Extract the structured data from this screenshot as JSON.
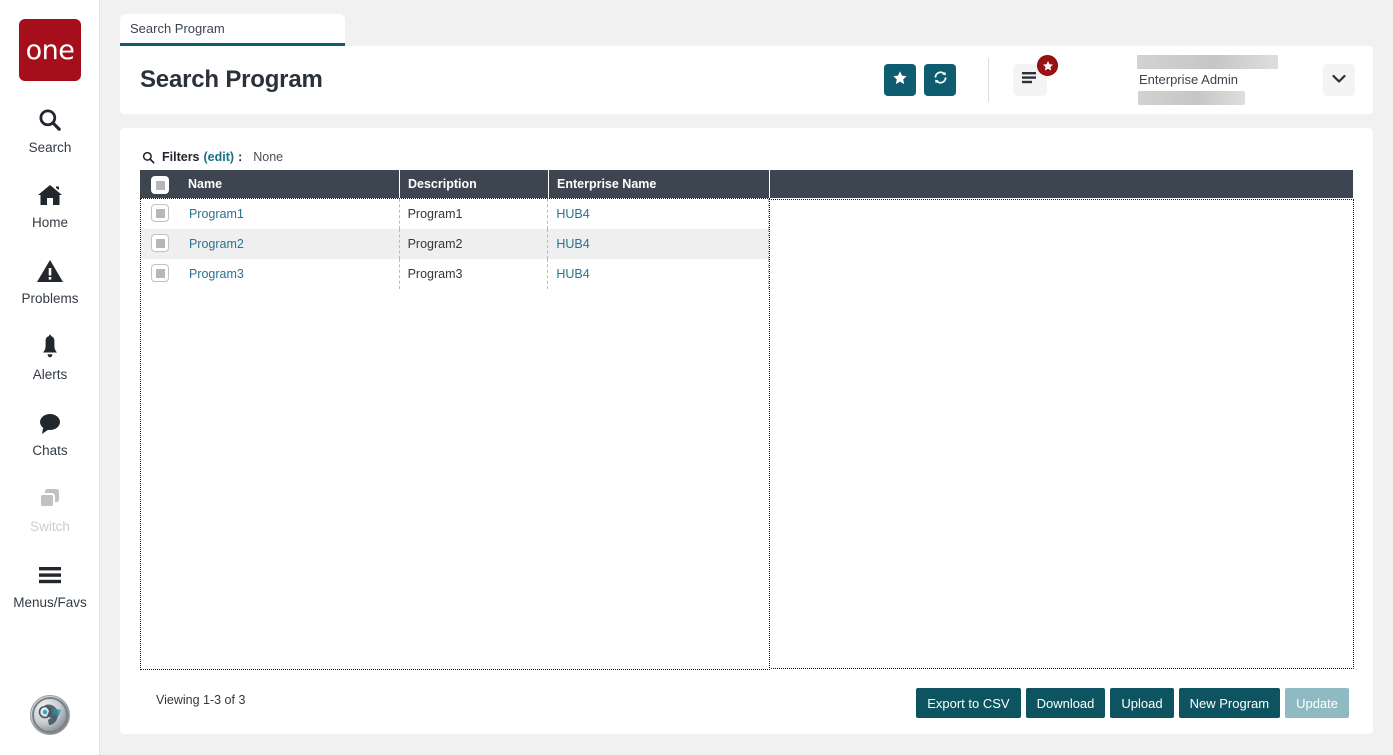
{
  "sidebar": {
    "logo_text": "one",
    "items": [
      {
        "label": "Search",
        "icon": "search-icon",
        "disabled": false
      },
      {
        "label": "Home",
        "icon": "home-icon",
        "disabled": false
      },
      {
        "label": "Problems",
        "icon": "warning-icon",
        "disabled": false
      },
      {
        "label": "Alerts",
        "icon": "bell-icon",
        "disabled": false
      },
      {
        "label": "Chats",
        "icon": "chat-icon",
        "disabled": false
      },
      {
        "label": "Switch",
        "icon": "switch-icon",
        "disabled": true
      },
      {
        "label": "Menus/Favs",
        "icon": "hamburger-icon",
        "disabled": false
      }
    ]
  },
  "tab": {
    "label": "Search Program"
  },
  "header": {
    "title": "Search Program",
    "favorite_icon": "star-icon",
    "refresh_icon": "refresh-icon",
    "menu_icon": "hamburger-menu-icon",
    "menu_badge_icon": "star-badge-icon",
    "user_role": "Enterprise Admin",
    "chevron_icon": "chevron-down-icon"
  },
  "filters": {
    "icon": "magnifier-icon",
    "label": "Filters",
    "edit_label": "(edit)",
    "colon": ":",
    "value": "None"
  },
  "table": {
    "columns": [
      "Name",
      "Description",
      "Enterprise Name"
    ],
    "rows": [
      {
        "name": "Program1",
        "description": "Program1",
        "enterprise": "HUB4"
      },
      {
        "name": "Program2",
        "description": "Program2",
        "enterprise": "HUB4"
      },
      {
        "name": "Program3",
        "description": "Program3",
        "enterprise": "HUB4"
      }
    ]
  },
  "footer": {
    "viewing": "Viewing 1-3 of 3",
    "buttons": [
      {
        "label": "Export to CSV",
        "disabled": false
      },
      {
        "label": "Download",
        "disabled": false
      },
      {
        "label": "Upload",
        "disabled": false
      },
      {
        "label": "New Program",
        "disabled": false
      },
      {
        "label": "Update",
        "disabled": true
      }
    ]
  },
  "colors": {
    "brand_red": "#a50f1b",
    "teal": "#0d5c70",
    "button_teal": "#0d5460",
    "button_teal_disabled": "#8fbac3",
    "header_slate": "#3d4551",
    "link_blue": "#2a7490",
    "page_bg": "#f1f1f1",
    "badge_red": "#9b1010"
  }
}
